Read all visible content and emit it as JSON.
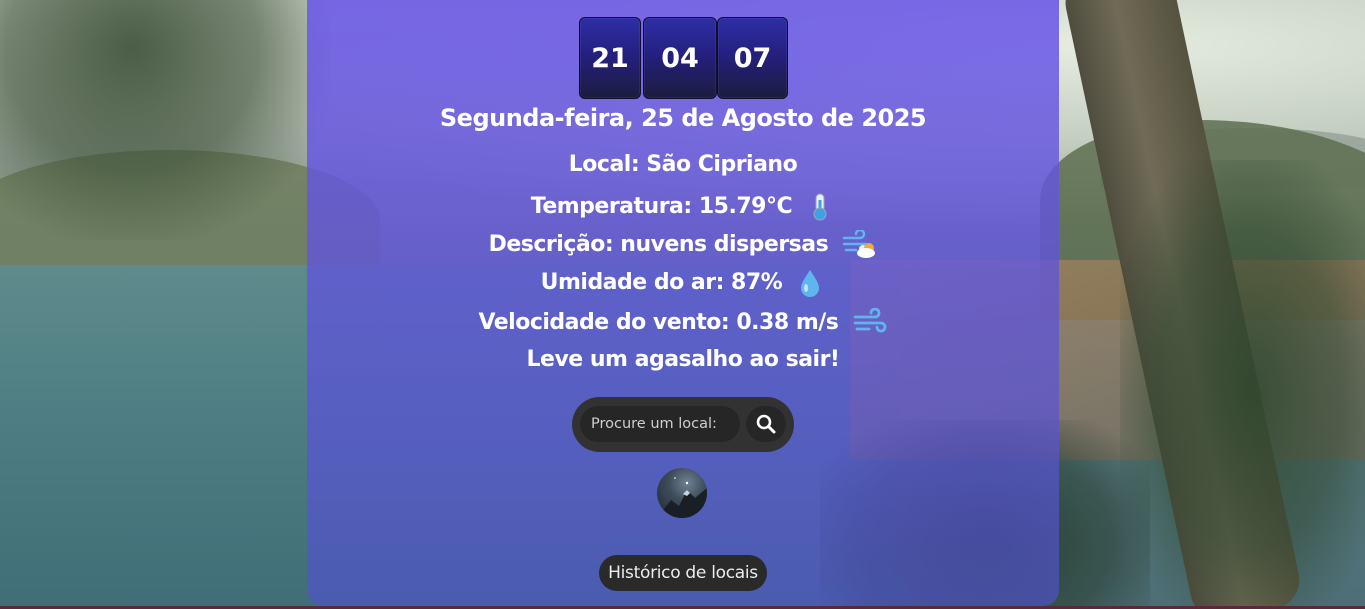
{
  "clock": {
    "hours": "21",
    "minutes": "04",
    "seconds": "07"
  },
  "date": "Segunda-feira, 25 de Agosto de 2025",
  "weather": {
    "location": "Local: São Cipriano",
    "temperature": "Temperatura: 15.79°C",
    "temperature_icon": "thermometer-icon",
    "description": "Descrição: nuvens dispersas",
    "description_icon": "wind-cloud-icon",
    "humidity": "Umidade do ar: 87%",
    "humidity_icon": "droplet-icon",
    "wind": "Velocidade do vento: 0.38 m/s",
    "wind_icon": "wind-icon",
    "advice": "Leve um agasalho ao sair!"
  },
  "search": {
    "placeholder": "Procure um local:",
    "button_icon": "search-icon"
  },
  "history_button": "Histórico de locais",
  "colors": {
    "card_top": "#6c58e8",
    "card_bottom": "#5052cd",
    "clock_box": "#242080",
    "search_bg": "#333233",
    "history_bg": "#2a2a2a"
  }
}
